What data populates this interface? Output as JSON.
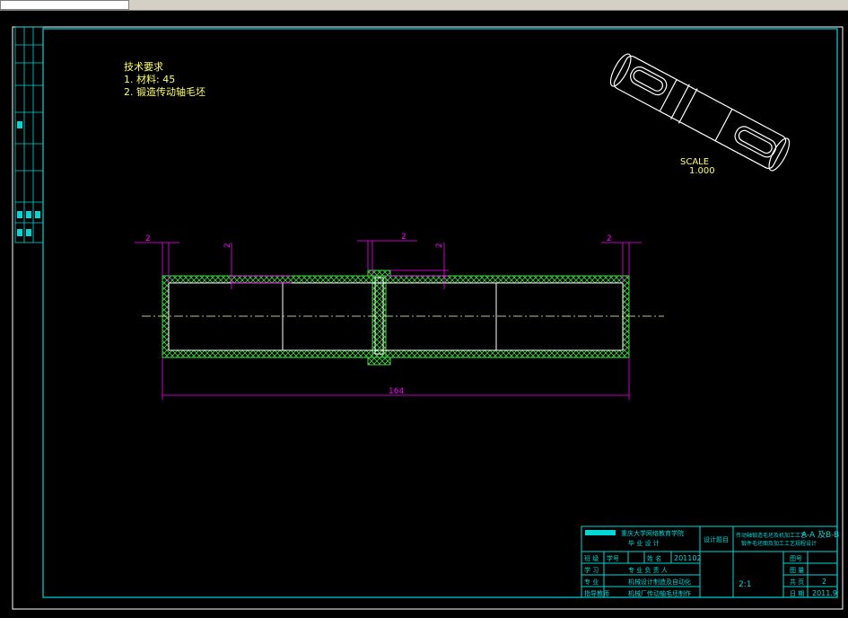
{
  "window": {
    "title": ""
  },
  "tech": {
    "title": "技术要求",
    "line1": "1. 材料: 45",
    "line2": "2. 锻造传动轴毛坯"
  },
  "iso": {
    "scale_label": "SCALE",
    "scale_value": "1.000"
  },
  "dims": {
    "top_left": "2",
    "top_center": "2",
    "top_right": "2",
    "step_left": "2",
    "step_right": "2",
    "overall": "164"
  },
  "titleblock": {
    "school": "重庆大学网络教育学院",
    "subtitle": "毕 业 设 计",
    "design_topic": "设计题目",
    "topic_text": "传动轴锻造毛坯及机加工工艺",
    "section": "A-A 及B-B",
    "topic_sub": "锻件毛坯图及加工工艺规程设计",
    "r1": [
      "班 级",
      "学号",
      "姓 名",
      "201102"
    ],
    "r2": [
      "学 习",
      "专 业 负 责 人"
    ],
    "r3": [
      "专 业",
      "机械设计制造及自动化"
    ],
    "r4": [
      "指导教师",
      "机械厂传动轴毛坯制作"
    ],
    "scale": "2:1",
    "r_right": [
      [
        "图号",
        ""
      ],
      [
        "图 量",
        ""
      ],
      [
        "共 页",
        "2"
      ],
      [
        "日 期",
        "2011.9"
      ]
    ]
  },
  "colors": {
    "frame": "#00d7d7",
    "wire": "#ffffff",
    "dim": "#ff00ff",
    "text": "#ffff66",
    "hatch": "#3fd63f",
    "center": "#ffff99"
  }
}
